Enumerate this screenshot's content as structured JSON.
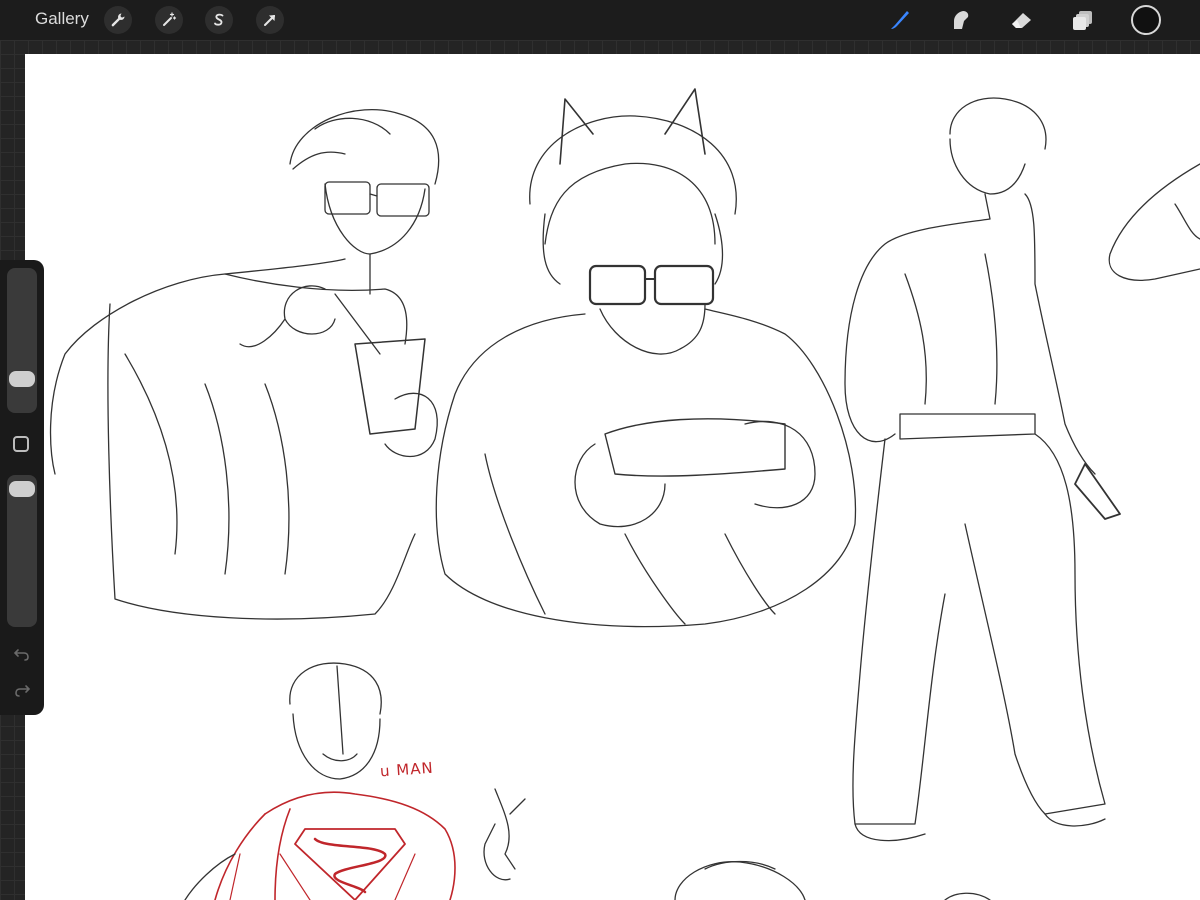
{
  "toolbar": {
    "gallery_label": "Gallery",
    "left_tools": [
      {
        "name": "actions",
        "icon": "wrench-icon"
      },
      {
        "name": "adjustments",
        "icon": "magic-wand-icon"
      },
      {
        "name": "selection",
        "icon": "selection-s-icon"
      },
      {
        "name": "transform",
        "icon": "arrow-cursor-icon"
      }
    ],
    "right_tools": [
      {
        "name": "brush",
        "icon": "brush-icon",
        "active": true
      },
      {
        "name": "smudge",
        "icon": "smudge-finger-icon",
        "active": false
      },
      {
        "name": "eraser",
        "icon": "eraser-icon",
        "active": false
      },
      {
        "name": "layers",
        "icon": "layers-icon",
        "active": false
      }
    ],
    "current_color": "#111111",
    "active_color": "#3a86ff"
  },
  "sidebar": {
    "brush_size_level": 0.3,
    "opacity_level": 0.05,
    "modifier_icon": "square-modify-icon",
    "undo_icon": "undo-arrow-icon",
    "redo_icon": "redo-arrow-icon"
  },
  "canvas": {
    "handwritten_note": "u MAN",
    "ink_color": "#333333",
    "accent_ink_color": "#c0262b",
    "background": "#ffffff"
  }
}
